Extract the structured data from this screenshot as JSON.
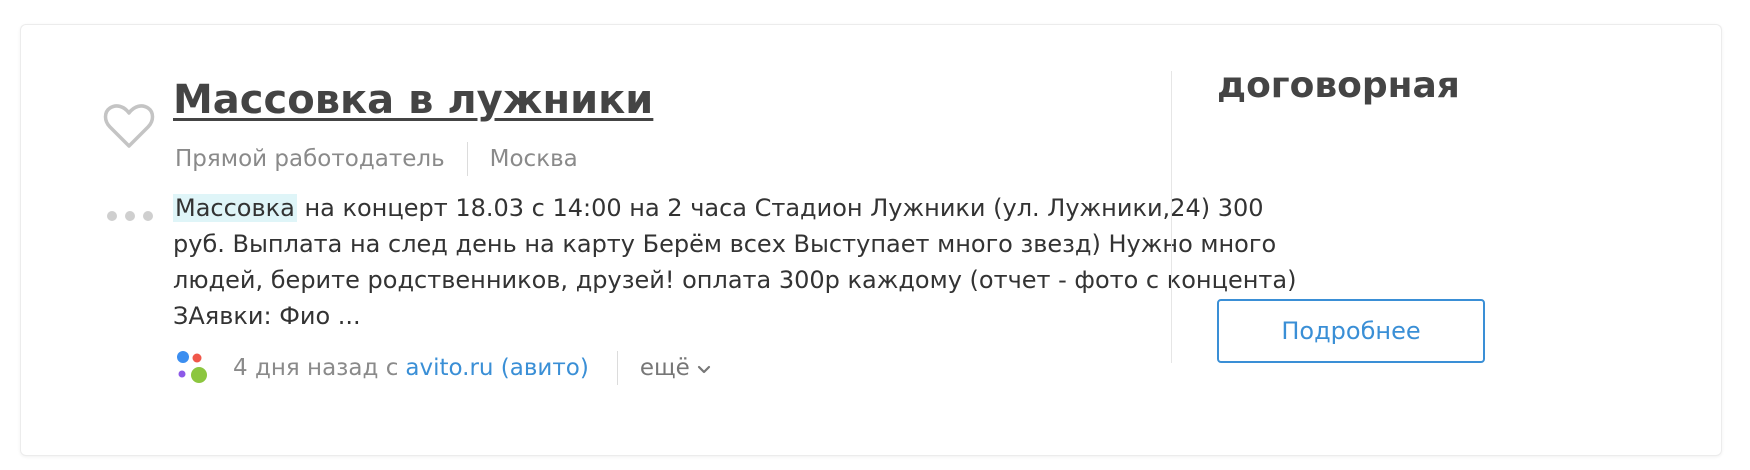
{
  "listing": {
    "title": "Массовка в лужники",
    "employer_type": "Прямой работодатель",
    "city": "Москва",
    "description_highlight": "Массовка",
    "description_rest": " на концерт 18.03 с 14:00 на 2 часа Стадион Лужники (ул. Лужники,24) 300 руб. Выплата на след день на карту Берём всех Выступает много звезд) Нужно много людей, берите родственников, друзей! оплата 300р каждому (отчет - фото с концента) ЗАявки: Фио ...",
    "posted": "4 дня назад с",
    "source_link": "avito.ru (авито)",
    "more_label": "ещё",
    "price": "договорная",
    "details_button": "Подробнее"
  },
  "icons": {
    "favorite": "heart-outline-icon",
    "options": "more-dots-icon",
    "source": "avito-logo-icon",
    "more": "chevron-down-icon"
  },
  "colors": {
    "link": "#3a8fd6",
    "highlight": "#dff5f8",
    "title": "#444444",
    "muted": "#8a8a8a"
  }
}
